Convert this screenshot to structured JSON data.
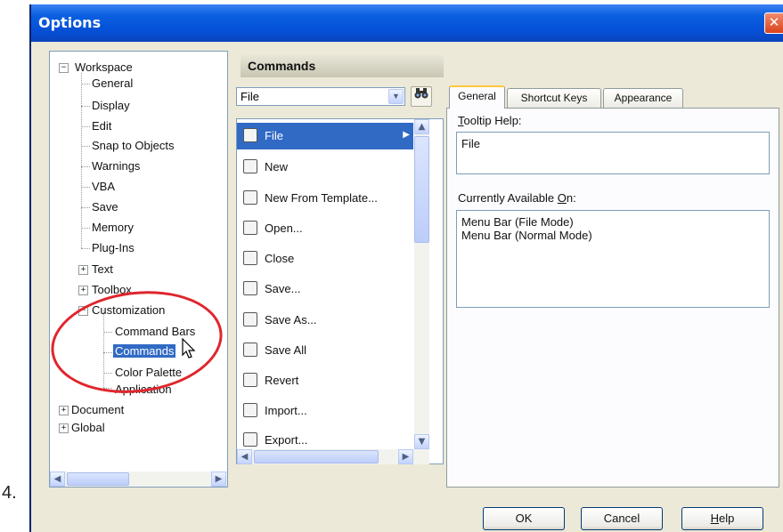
{
  "step_number": "4.",
  "window": {
    "title": "Options",
    "close_glyph": "✕"
  },
  "tree": {
    "items": [
      {
        "label": "Workspace",
        "expander": "−"
      },
      {
        "label": "General"
      },
      {
        "label": "Display"
      },
      {
        "label": "Edit"
      },
      {
        "label": "Snap to Objects"
      },
      {
        "label": "Warnings"
      },
      {
        "label": "VBA"
      },
      {
        "label": "Save"
      },
      {
        "label": "Memory"
      },
      {
        "label": "Plug-Ins"
      },
      {
        "label": "Text",
        "expander": "+"
      },
      {
        "label": "Toolbox",
        "expander": "+"
      },
      {
        "label": "Customization",
        "expander": "−"
      },
      {
        "label": "Command Bars"
      },
      {
        "label": "Commands",
        "selected": true
      },
      {
        "label": "Color Palette"
      },
      {
        "label": "Application"
      },
      {
        "label": "Document",
        "expander": "+"
      },
      {
        "label": "Global",
        "expander": "+"
      }
    ]
  },
  "commands": {
    "header": "Commands",
    "combo_value": "File",
    "find_icon": "binoculars-icon",
    "list": [
      {
        "label": "File",
        "icon": "page-icon",
        "selected": true
      },
      {
        "label": "New",
        "icon": "new-document-icon"
      },
      {
        "label": "New From Template...",
        "icon": "template-icon"
      },
      {
        "label": "Open...",
        "icon": "open-folder-icon"
      },
      {
        "label": "Close",
        "icon": "close-document-icon"
      },
      {
        "label": "Save...",
        "icon": "save-icon"
      },
      {
        "label": "Save As...",
        "icon": "save-as-icon"
      },
      {
        "label": "Save All",
        "icon": "save-all-icon"
      },
      {
        "label": "Revert",
        "icon": "revert-icon"
      },
      {
        "label": "Import...",
        "icon": "import-icon"
      },
      {
        "label": "Export...",
        "icon": "export-icon"
      }
    ]
  },
  "tabs": {
    "labels": [
      "General",
      "Shortcut Keys",
      "Appearance"
    ],
    "active": "General"
  },
  "general": {
    "tooltip_label_key": "T",
    "tooltip_label_rest": "ooltip Help:",
    "tooltip_value": "File",
    "available_label_pre": "Currently Available ",
    "available_label_key": "O",
    "available_label_post": "n:",
    "available_items": [
      "Menu Bar (File Mode)",
      "Menu Bar (Normal Mode)"
    ]
  },
  "buttons": {
    "ok": "OK",
    "cancel": "Cancel",
    "help_key": "H",
    "help_rest": "elp"
  },
  "annotation_color": "#e0252d",
  "selection_color": "#316ac5"
}
